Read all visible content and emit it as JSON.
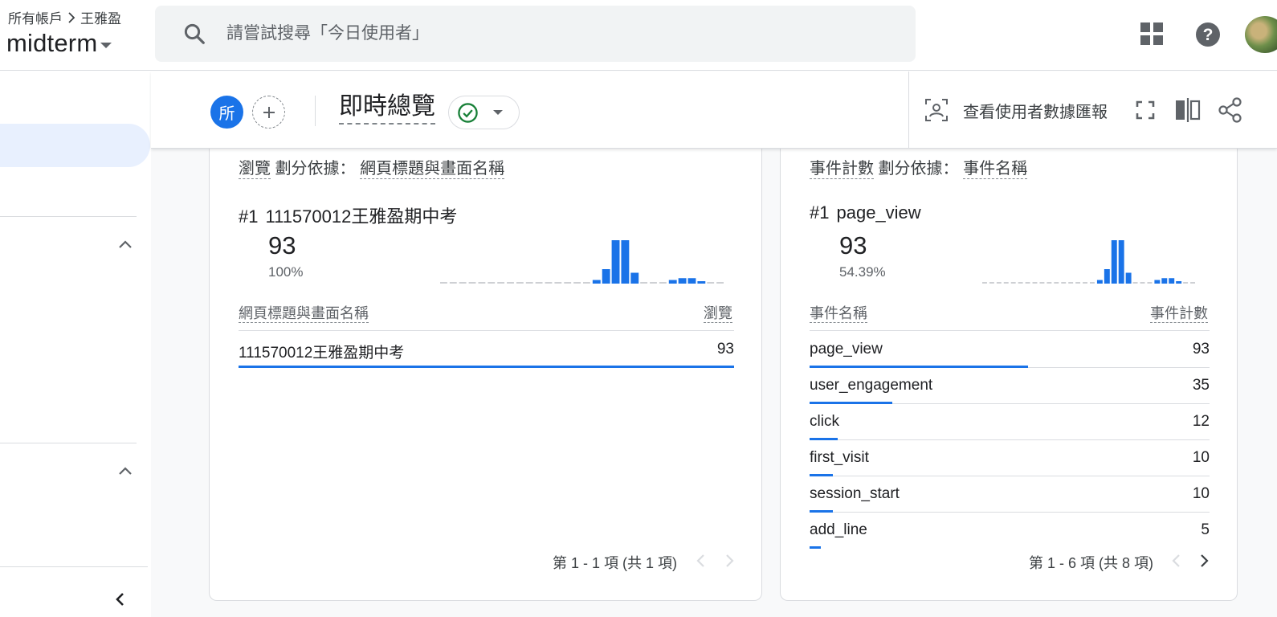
{
  "header": {
    "breadcrumb": {
      "account": "所有帳戶",
      "property": "王雅盈"
    },
    "property_name": "midterm",
    "search_placeholder": "請嘗試搜尋「今日使用者」"
  },
  "toolbar": {
    "segment_chip": "所",
    "report_title": "即時總覽",
    "user_snapshot_label": "查看使用者數據匯報"
  },
  "cards": [
    {
      "metric": "瀏覽",
      "split_by_label": "劃分依據：",
      "dimension": "網頁標題與畫面名稱",
      "top_rank": "#1",
      "top_item": "111570012王雅盈期中考",
      "top_value": "93",
      "top_pct": "100%",
      "sparkline": [
        0,
        0,
        0,
        0,
        0,
        0,
        0,
        0,
        0,
        0,
        0,
        0,
        0,
        0,
        0,
        0,
        1,
        4,
        12,
        12,
        3,
        0,
        0,
        0,
        1,
        1.5,
        1.5,
        0.5,
        0,
        0
      ],
      "columns": [
        "網頁標題與畫面名稱",
        "瀏覽"
      ],
      "rows": [
        {
          "label": "111570012王雅盈期中考",
          "value": "93",
          "share": 1.0
        }
      ],
      "pager": "第 1 - 1 項 (共 1 項)"
    },
    {
      "metric": "事件計數",
      "split_by_label": "劃分依據：",
      "dimension": "事件名稱",
      "top_rank": "#1",
      "top_item": "page_view",
      "top_value": "93",
      "top_pct": "54.39%",
      "sparkline": [
        0,
        0,
        0,
        0,
        0,
        0,
        0,
        0,
        0,
        0,
        0,
        0,
        0,
        0,
        0,
        0,
        1,
        4,
        12,
        12,
        3,
        0,
        0,
        0,
        1,
        1.5,
        1.5,
        0.5,
        0,
        0
      ],
      "columns": [
        "事件名稱",
        "事件計數"
      ],
      "rows": [
        {
          "label": "page_view",
          "value": "93",
          "share": 0.546
        },
        {
          "label": "user_engagement",
          "value": "35",
          "share": 0.206
        },
        {
          "label": "click",
          "value": "12",
          "share": 0.071
        },
        {
          "label": "first_visit",
          "value": "10",
          "share": 0.059
        },
        {
          "label": "session_start",
          "value": "10",
          "share": 0.059
        },
        {
          "label": "add_line",
          "value": "5",
          "share": 0.029
        }
      ],
      "pager": "第 1 - 6 項 (共 8 項)"
    }
  ],
  "colors": {
    "accent": "#1a73e8",
    "success": "#188038",
    "text": "#202124",
    "muted": "#5f6368"
  },
  "icons": [
    "search-icon",
    "apps-grid-icon",
    "help-icon",
    "add-icon",
    "check-circle-icon",
    "user-snapshot-icon",
    "fullscreen-icon",
    "compare-icon",
    "share-icon",
    "chevron-up-icon",
    "chevron-left-icon",
    "chevron-right-icon"
  ]
}
